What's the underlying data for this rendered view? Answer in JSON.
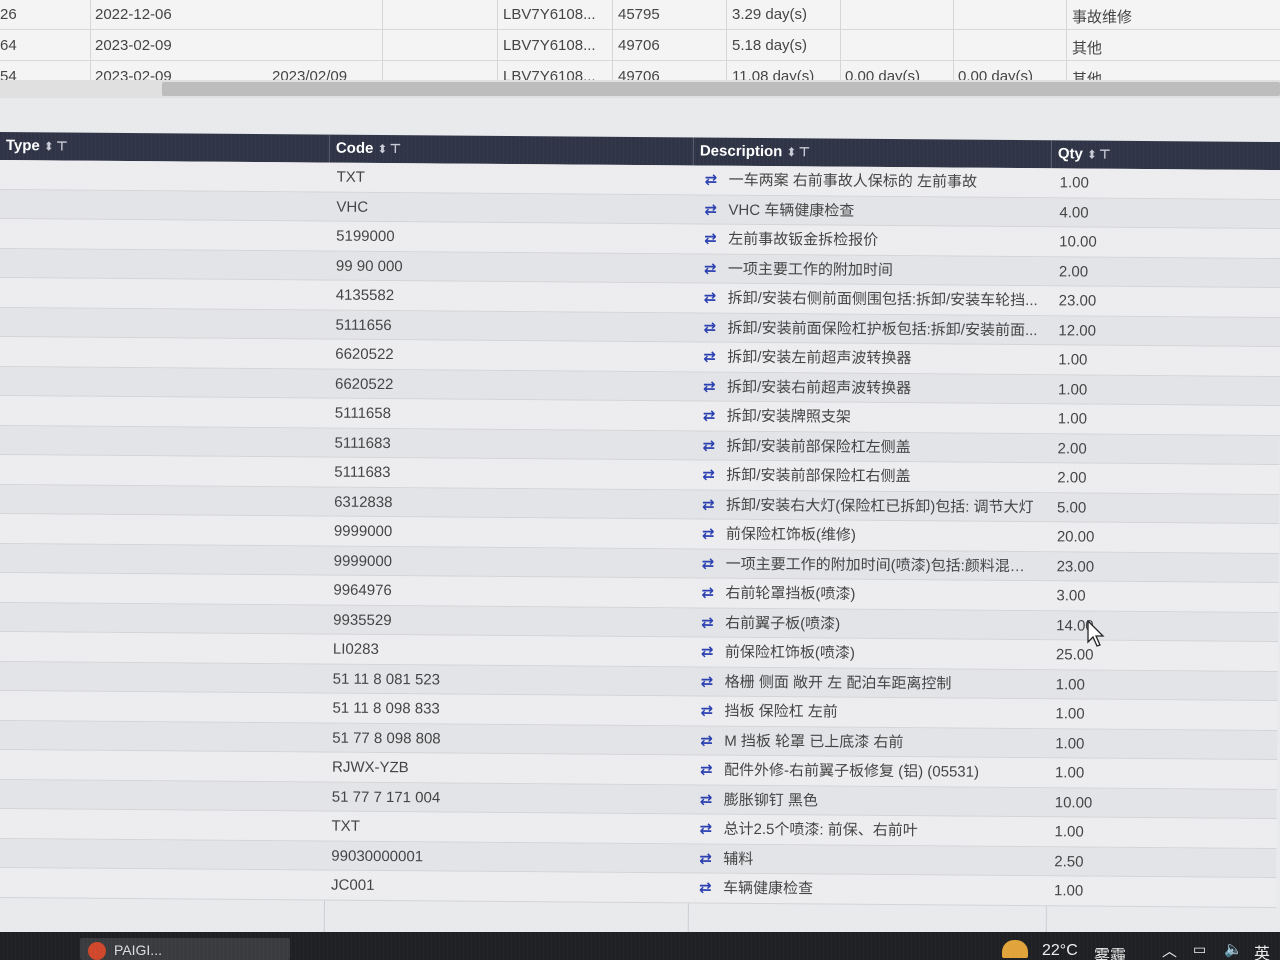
{
  "top_grid": {
    "rows": [
      {
        "id": "26",
        "date": "2022-12-06",
        "date2": "",
        "vin": "LBV7Y6108...",
        "mileage": "45795",
        "duration": "3.29 day(s)",
        "duration2": "",
        "duration3": "",
        "type": "事故维修"
      },
      {
        "id": "64",
        "date": "2023-02-09",
        "date2": "",
        "vin": "LBV7Y6108...",
        "mileage": "49706",
        "duration": "5.18 day(s)",
        "duration2": "",
        "duration3": "",
        "type": "其他"
      },
      {
        "id": "54",
        "date": "2023-02-09",
        "date2": "2023/02/09",
        "vin": "LBV7Y6108...",
        "mileage": "49706",
        "duration": "11.08 day(s)",
        "duration2": "0.00 day(s)",
        "duration3": "0.00 day(s)",
        "type": "其他"
      }
    ]
  },
  "table": {
    "columns": [
      "Type",
      "Code",
      "Description",
      "Qty"
    ],
    "rows": [
      {
        "code": "TXT",
        "description": "一车两案 右前事故人保标的 左前事故",
        "qty": "1.00"
      },
      {
        "code": "VHC",
        "description": "VHC 车辆健康检查",
        "qty": "4.00"
      },
      {
        "code": "5199000",
        "description": "左前事故钣金拆检报价",
        "qty": "10.00"
      },
      {
        "code": "99 90 000",
        "description": "一项主要工作的附加时间",
        "qty": "2.00"
      },
      {
        "code": "4135582",
        "description": "拆卸/安装右侧前面侧围包括:拆卸/安装车轮挡...",
        "qty": "23.00"
      },
      {
        "code": "5111656",
        "description": "拆卸/安装前面保险杠护板包括:拆卸/安装前面...",
        "qty": "12.00"
      },
      {
        "code": "6620522",
        "description": "拆卸/安装左前超声波转换器",
        "qty": "1.00"
      },
      {
        "code": "6620522",
        "description": "拆卸/安装右前超声波转换器",
        "qty": "1.00"
      },
      {
        "code": "5111658",
        "description": "拆卸/安装牌照支架",
        "qty": "1.00"
      },
      {
        "code": "5111683",
        "description": "拆卸/安装前部保险杠左侧盖",
        "qty": "2.00"
      },
      {
        "code": "5111683",
        "description": "拆卸/安装前部保险杠右侧盖",
        "qty": "2.00"
      },
      {
        "code": "6312838",
        "description": "拆卸/安装右大灯(保险杠已拆卸)包括: 调节大灯",
        "qty": "5.00"
      },
      {
        "code": "9999000",
        "description": "前保险杠饰板(维修)",
        "qty": "20.00"
      },
      {
        "code": "9999000",
        "description": "一项主要工作的附加时间(喷漆)包括:颜料混合...",
        "qty": "23.00"
      },
      {
        "code": "9964976",
        "description": "右前轮罩挡板(喷漆)",
        "qty": "3.00"
      },
      {
        "code": "9935529",
        "description": "右前翼子板(喷漆)",
        "qty": "14.00"
      },
      {
        "code": "LI0283",
        "description": "前保险杠饰板(喷漆)",
        "qty": "25.00"
      },
      {
        "code": "51 11 8 081 523",
        "description": "格栅 侧面 敞开 左 配泊车距离控制",
        "qty": "1.00"
      },
      {
        "code": "51 11 8 098 833",
        "description": "挡板 保险杠 左前",
        "qty": "1.00"
      },
      {
        "code": "51 77 8 098 808",
        "description": "M 挡板 轮罩 已上底漆 右前",
        "qty": "1.00"
      },
      {
        "code": "RJWX-YZB",
        "description": "配件外修-右前翼子板修复 (铝) (05531)",
        "qty": "1.00"
      },
      {
        "code": "51 77 7 171 004",
        "description": "膨胀铆钉 黑色",
        "qty": "10.00"
      },
      {
        "code": "TXT",
        "description": "总计2.5个喷漆: 前保、右前叶",
        "qty": "1.00"
      },
      {
        "code": "99030000001",
        "description": "辅料",
        "qty": "2.50"
      },
      {
        "code": "JC001",
        "description": "车辆健康检查",
        "qty": "1.00"
      }
    ]
  },
  "taskbar": {
    "app_label": "PAIGI...",
    "temperature": "22°C",
    "weather": "雾霾",
    "ime": "英"
  }
}
